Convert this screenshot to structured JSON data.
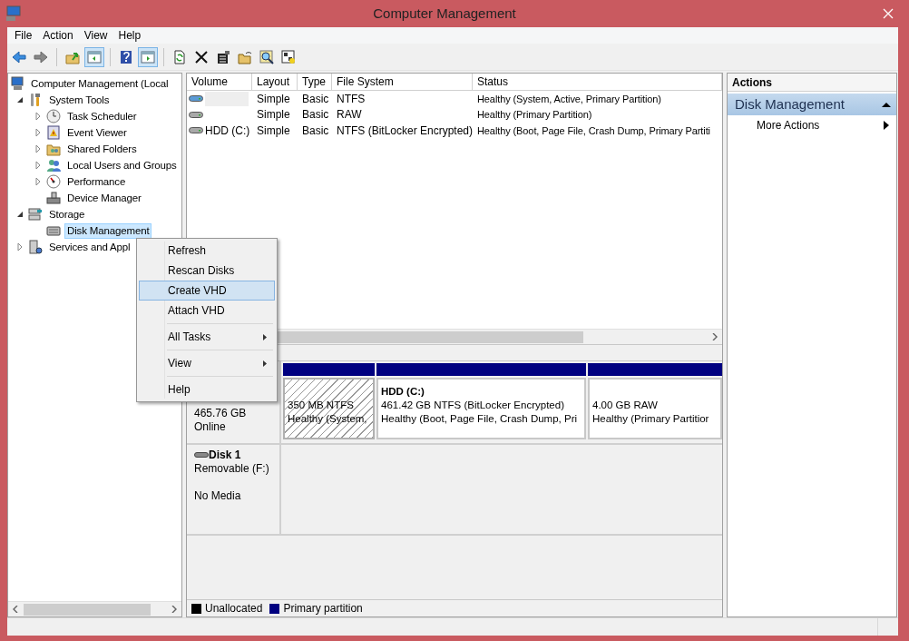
{
  "window": {
    "title": "Computer Management"
  },
  "menu_bar": [
    "File",
    "Action",
    "View",
    "Help"
  ],
  "toolbar": [
    {
      "kind": "back",
      "pressed": false
    },
    {
      "kind": "forward",
      "pressed": false
    },
    {
      "kind": "separator"
    },
    {
      "kind": "up",
      "pressed": false
    },
    {
      "kind": "tree",
      "pressed": true
    },
    {
      "kind": "separator"
    },
    {
      "kind": "help",
      "pressed": false
    },
    {
      "kind": "actionpane",
      "pressed": true
    },
    {
      "kind": "separator"
    },
    {
      "kind": "refresh",
      "pressed": false
    },
    {
      "kind": "delete",
      "pressed": false
    },
    {
      "kind": "properties",
      "pressed": false
    },
    {
      "kind": "open",
      "pressed": false
    },
    {
      "kind": "search",
      "pressed": false
    },
    {
      "kind": "settings",
      "pressed": false
    }
  ],
  "tree": [
    {
      "label": "Computer Management (Local",
      "kind": "computer",
      "selected": false,
      "children": [
        {
          "label": "System Tools",
          "kind": "tools",
          "selected": false,
          "expanded": true,
          "children": [
            {
              "label": "Task Scheduler",
              "kind": "clock",
              "selected": false,
              "expanded": false
            },
            {
              "label": "Event Viewer",
              "kind": "event",
              "selected": false,
              "expanded": false
            },
            {
              "label": "Shared Folders",
              "kind": "share",
              "selected": false,
              "expanded": false
            },
            {
              "label": "Local Users and Groups",
              "kind": "users",
              "selected": false,
              "expanded": false
            },
            {
              "label": "Performance",
              "kind": "gauge",
              "selected": false,
              "expanded": false
            },
            {
              "label": "Device Manager",
              "kind": "device",
              "selected": false
            }
          ]
        },
        {
          "label": "Storage",
          "kind": "storage",
          "selected": false,
          "expanded": true,
          "children": [
            {
              "label": "Disk Management",
              "kind": "disk",
              "selected": true
            }
          ]
        },
        {
          "label": "Services and Appl",
          "kind": "services",
          "selected": false,
          "expanded": false
        }
      ]
    }
  ],
  "volume_table": {
    "columns": [
      "Volume",
      "Layout",
      "Type",
      "File System",
      "Status"
    ],
    "rows": [
      {
        "color": "#5b9bd5",
        "selected": true,
        "layout": "Simple",
        "type": "Basic",
        "file_system": "NTFS",
        "status": "Healthy (System, Active, Primary Partition)"
      },
      {
        "color": "#a8a8a8",
        "selected": false,
        "layout": "Simple",
        "type": "Basic",
        "file_system": "RAW",
        "status": "Healthy (Primary Partition)"
      },
      {
        "volume": "HDD (C:)",
        "color": "#a8a8a8",
        "selected": false,
        "layout": "Simple",
        "type": "Basic",
        "file_system": "NTFS (BitLocker Encrypted)",
        "status": "Healthy (Boot, Page File, Crash Dump, Primary Partiti"
      }
    ]
  },
  "disks": [
    {
      "detail": "465.76 GB",
      "state": "Online",
      "partitions": [
        {
          "kind": "hatched",
          "size": "350 MB NTFS",
          "status": "Healthy (System,"
        },
        {
          "kind": "plain",
          "name": "HDD  (C:)",
          "size": "461.42 GB NTFS (BitLocker Encrypted)",
          "status": "Healthy (Boot, Page File, Crash Dump, Pri"
        },
        {
          "kind": "plain",
          "size": "4.00 GB RAW",
          "status": "Healthy (Primary Partitior"
        }
      ]
    },
    {
      "name": "Disk 1",
      "detail": "Removable (F:)",
      "state": "No Media"
    }
  ],
  "legend": [
    {
      "label": "Unallocated",
      "color": "#000000"
    },
    {
      "label": "Primary partition",
      "color": "#000080"
    }
  ],
  "actions": {
    "header": "Actions",
    "section": "Disk Management",
    "expanded": true,
    "items": [
      {
        "label": "More Actions",
        "submenu": true
      }
    ]
  },
  "context_menu": [
    {
      "kind": "item",
      "label": "Refresh",
      "selected": false,
      "submenu": false
    },
    {
      "kind": "item",
      "label": "Rescan Disks",
      "selected": false,
      "submenu": false
    },
    {
      "kind": "item",
      "label": "Create VHD",
      "selected": true,
      "submenu": false
    },
    {
      "kind": "item",
      "label": "Attach VHD",
      "selected": false,
      "submenu": false
    },
    {
      "kind": "separator"
    },
    {
      "kind": "item",
      "label": "All Tasks",
      "selected": false,
      "submenu": true
    },
    {
      "kind": "separator"
    },
    {
      "kind": "item",
      "label": "View",
      "selected": false,
      "submenu": true
    },
    {
      "kind": "separator"
    },
    {
      "kind": "item",
      "label": "Help",
      "selected": false,
      "submenu": false
    }
  ]
}
